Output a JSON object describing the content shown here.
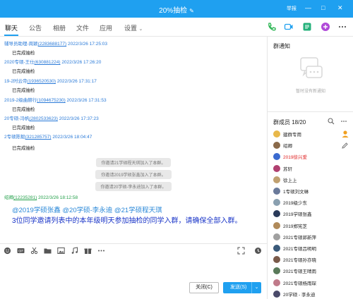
{
  "titlebar": {
    "title": "20%抽检",
    "help": "举报",
    "minimize": "—",
    "maximize": "□",
    "close": "✕"
  },
  "tabs": [
    {
      "label": "聊天"
    },
    {
      "label": "公告"
    },
    {
      "label": "相册"
    },
    {
      "label": "文件"
    },
    {
      "label": "应用"
    },
    {
      "label": "设置"
    }
  ],
  "messages": [
    {
      "name": "辅导员助理-周颖",
      "id": "(2283688177)",
      "time": "2022/3/26 17:25:03",
      "body": "已完成抽检"
    },
    {
      "name": "2020专硕-王仕",
      "id": "(630881224)",
      "time": "2022/3/26 17:26:20",
      "body": "已完成抽检"
    },
    {
      "name": "19-2时云帝",
      "id": "(1936520530)",
      "time": "2022/3/26 17:31:17",
      "body": "已完成抽检"
    },
    {
      "name": "2019-2级曲赫行",
      "id": "(1094675230)",
      "time": "2022/3/26 17:31:53",
      "body": "已完成抽检"
    },
    {
      "name": "20专硕-冯帆",
      "id": "(2802533623)",
      "time": "2022/3/26 17:37:23",
      "body": "已完成抽检"
    },
    {
      "name": "2专硕陈毅",
      "id": "(321285757)",
      "time": "2022/3/26 18:04:47",
      "body": "已完成抽检"
    }
  ],
  "system_notes": [
    "你邀请21学硕程天琪加入了本群。",
    "你邀请2019学硕张鑫加入了本群。",
    "你邀请20学硕-李永迪加入了本群。"
  ],
  "last_message": {
    "name": "绍卿",
    "id": "(12235281)",
    "time": "2022/3/26 18:12:58",
    "mentions": "@2019学硕张鑫 @20学硕-李永迪 @21学硕程天琪",
    "body": "3位同学邀请列表中的本年级明天参加抽检的同学入群，请确保全部入群。"
  },
  "buttons": {
    "close": "关闭(C)",
    "send": "发送(S)"
  },
  "right_panel": {
    "notice_title": "群通知",
    "notice_empty": "暂时没有新通知",
    "members_title": "群成员 18/20"
  },
  "members": [
    {
      "name": "建群专用",
      "color": "#e8b84a"
    },
    {
      "name": "绍卿",
      "color": "#8a6a4a"
    },
    {
      "name": "2019徐兴爱",
      "color": "#3a6ad0",
      "red": true
    },
    {
      "name": "苏轩",
      "color": "#b04070"
    },
    {
      "name": "徐上上",
      "color": "#c0a070"
    },
    {
      "name": "1专硕刘文琳",
      "color": "#6a7a9a"
    },
    {
      "name": "2019级少东",
      "color": "#8aa0b0"
    },
    {
      "name": "2019学硕张鑫",
      "color": "#2a3a5a"
    },
    {
      "name": "2019郑宪芝",
      "color": "#b08a5a"
    },
    {
      "name": "2021专硕郭新萍",
      "color": "#a0a0a0"
    },
    {
      "name": "2021专硕吕明明",
      "color": "#3a5a7a"
    },
    {
      "name": "2021专硕孙亦晓",
      "color": "#7a5a4a"
    },
    {
      "name": "2021专硕王晴雨",
      "color": "#5a7a5a"
    },
    {
      "name": "2021专硕杨雨琛",
      "color": "#c07a8a"
    },
    {
      "name": "20学硕 - 李永迪",
      "color": "#4a4a6a"
    }
  ],
  "colors": {
    "accent": "#1fa0f0",
    "link": "#2a7ad8",
    "green_name": "#23a04a",
    "mention": "#2a88d8",
    "important_text": "#1a35c8"
  }
}
